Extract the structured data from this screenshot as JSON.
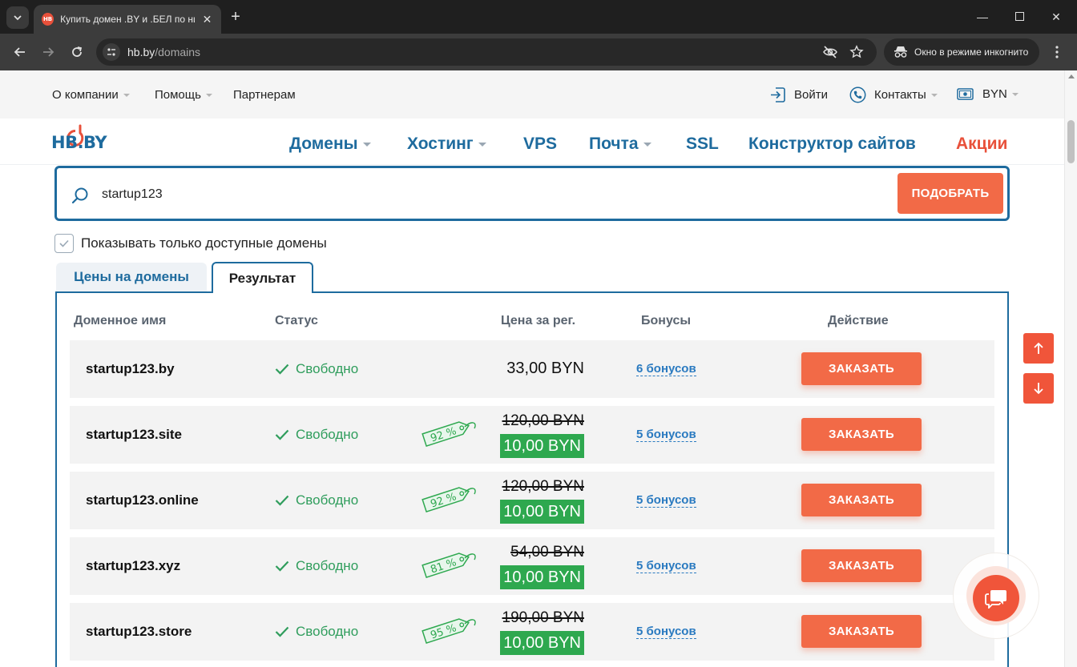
{
  "browser": {
    "tab_title": "Купить домен .BY и .БЕЛ по ни",
    "url_host": "hb.by",
    "url_path": "/domains",
    "incognito_label": "Окно в режиме инкогнито"
  },
  "topbar": {
    "about": "О компании",
    "help": "Помощь",
    "partners": "Партнерам",
    "login": "Войти",
    "contacts": "Контакты",
    "currency": "BYN"
  },
  "logo": "HB.BY",
  "mainnav": {
    "domains": "Домены",
    "hosting": "Хостинг",
    "vps": "VPS",
    "mail": "Почта",
    "ssl": "SSL",
    "builder": "Конструктор сайтов",
    "promo": "Акции"
  },
  "search": {
    "value": "startup123",
    "button": "ПОДОБРАТЬ"
  },
  "filter": {
    "only_available": "Показывать только доступные домены"
  },
  "tabs": {
    "prices": "Цены на домены",
    "result": "Результат"
  },
  "table": {
    "headers": {
      "domain": "Доменное имя",
      "status": "Статус",
      "price": "Цена за рег.",
      "bonuses": "Бонусы",
      "action": "Действие"
    },
    "rows": [
      {
        "domain": "startup123.by",
        "status": "Свободно",
        "price": "33,00 BYN",
        "old_price": "",
        "new_price": "",
        "discount": "",
        "bonus": "6 бонусов",
        "action": "ЗАКАЗАТЬ"
      },
      {
        "domain": "startup123.site",
        "status": "Свободно",
        "price": "",
        "old_price": "120,00 BYN",
        "new_price": "10,00 BYN",
        "discount": "92 %",
        "bonus": "5 бонусов",
        "action": "ЗАКАЗАТЬ"
      },
      {
        "domain": "startup123.online",
        "status": "Свободно",
        "price": "",
        "old_price": "120,00 BYN",
        "new_price": "10,00 BYN",
        "discount": "92 %",
        "bonus": "5 бонусов",
        "action": "ЗАКАЗАТЬ"
      },
      {
        "domain": "startup123.xyz",
        "status": "Свободно",
        "price": "",
        "old_price": "54,00 BYN",
        "new_price": "10,00 BYN",
        "discount": "81 %",
        "bonus": "5 бонусов",
        "action": "ЗАКАЗАТЬ"
      },
      {
        "domain": "startup123.store",
        "status": "Свободно",
        "price": "",
        "old_price": "190,00 BYN",
        "new_price": "10,00 BYN",
        "discount": "95 %",
        "bonus": "5 бонусов",
        "action": "ЗАКАЗАТЬ"
      }
    ]
  },
  "colors": {
    "brand_blue": "#1e6b9e",
    "accent_orange": "#f26a47",
    "promo_red": "#e8503a",
    "success_green": "#2ea84f"
  }
}
